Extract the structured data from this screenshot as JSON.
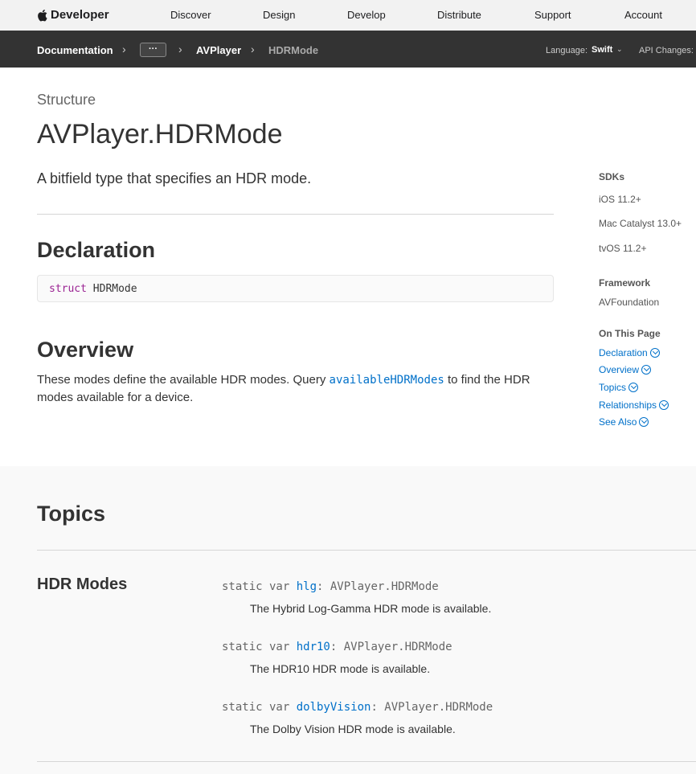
{
  "globalnav": {
    "brand": "Developer",
    "links": [
      "Discover",
      "Design",
      "Develop",
      "Distribute",
      "Support",
      "Account"
    ]
  },
  "localnav": {
    "crumbs": [
      "Documentation",
      "AVPlayer",
      "HDRMode"
    ],
    "ellipsis": "···",
    "language_label": "Language:",
    "language_value": "Swift",
    "api_changes_label": "API Changes:"
  },
  "main": {
    "eyebrow": "Structure",
    "title": "AVPlayer.HDRMode",
    "abstract": "A bitfield type that specifies an HDR mode.",
    "declaration_heading": "Declaration",
    "declaration_keyword": "struct",
    "declaration_name": "HDRMode",
    "overview_heading": "Overview",
    "overview_text_before": "These modes define the available HDR modes. Query ",
    "overview_link": "availableHDRModes",
    "overview_text_after": " to find the HDR modes available for a device."
  },
  "sidebar": {
    "sdks_label": "SDKs",
    "sdks": [
      "iOS 11.2+",
      "Mac Catalyst 13.0+",
      "tvOS 11.2+"
    ],
    "framework_label": "Framework",
    "framework": "AVFoundation",
    "on_this_page_label": "On This Page",
    "on_this_page": [
      "Declaration",
      "Overview",
      "Topics",
      "Relationships",
      "See Also"
    ]
  },
  "topics": {
    "title": "Topics",
    "group_title": "HDR Modes",
    "symbols": [
      {
        "prefix": "static var ",
        "name": "hlg",
        "suffix": ": AVPlayer.HDRMode",
        "desc": "The Hybrid Log-Gamma HDR mode is available."
      },
      {
        "prefix": "static var ",
        "name": "hdr10",
        "suffix": ": AVPlayer.HDRMode",
        "desc": "The HDR10 HDR mode is available."
      },
      {
        "prefix": "static var ",
        "name": "dolbyVision",
        "suffix": ": AVPlayer.HDRMode",
        "desc": "The Dolby Vision HDR mode is available."
      }
    ]
  },
  "colors": {
    "link": "#0070c9",
    "keyword": "#9b2393",
    "localnav_bg": "#333333"
  }
}
